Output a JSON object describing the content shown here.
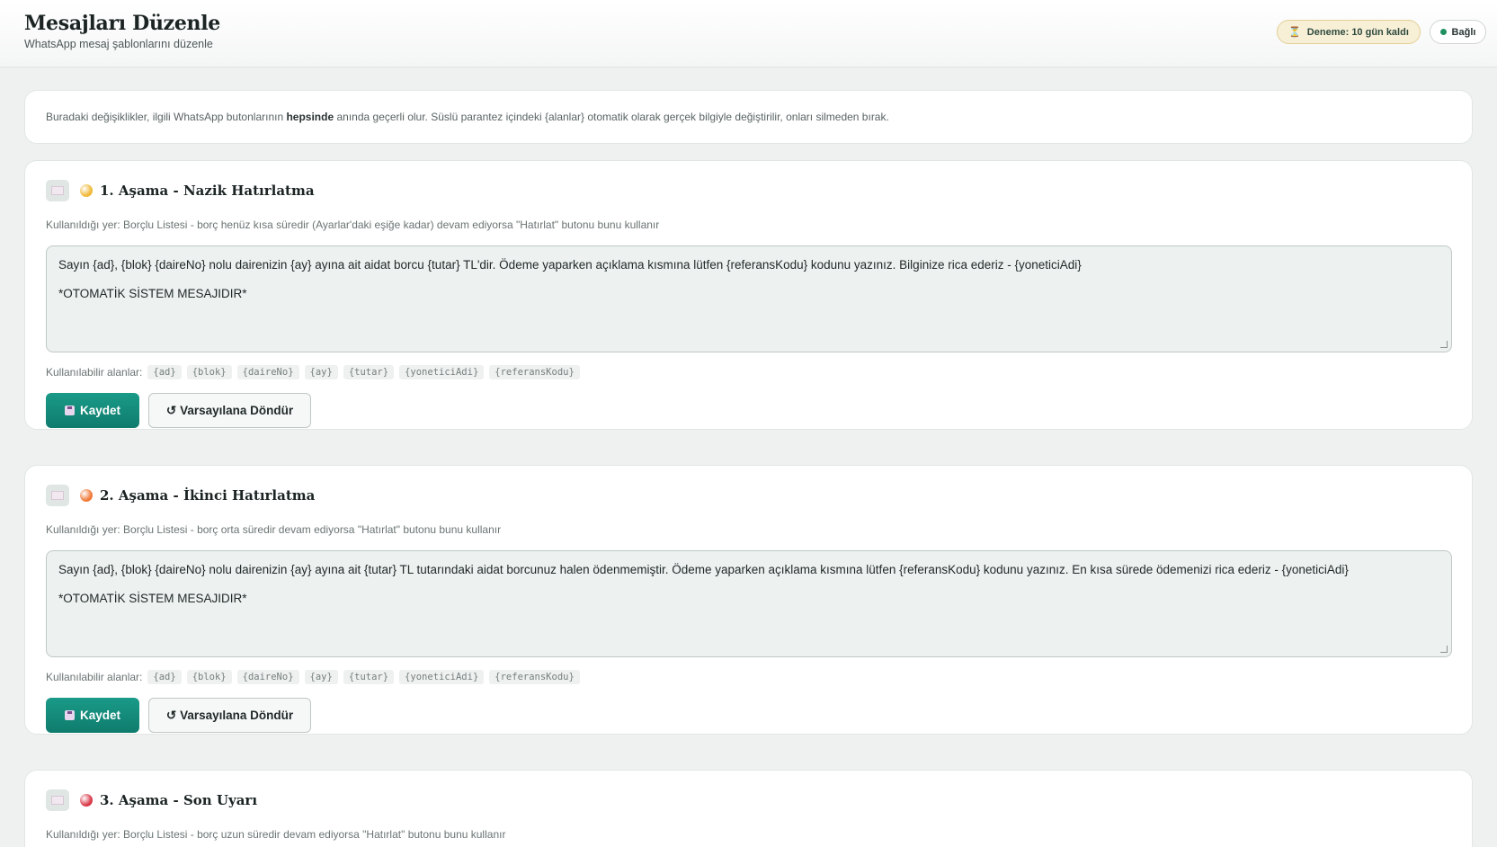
{
  "header": {
    "title": "Mesajları Düzenle",
    "subtitle": "WhatsApp mesaj şablonlarını düzenle",
    "trial_badge": "Deneme: 10 gün kaldı",
    "connection_status": "Bağlı"
  },
  "info": {
    "text_before": "Buradaki değişiklikler, ilgili WhatsApp butonlarının ",
    "text_bold": "hepsinde",
    "text_after": " anında geçerli olur. Süslü parantez içindeki {alanlar} otomatik olarak gerçek bilgiyle değiştirilir, onları silmeden bırak."
  },
  "labels": {
    "fields_label": "Kullanılabilir alanlar:",
    "save": "Kaydet",
    "reset": "Varsayılana Döndür",
    "reset_glyph": "↺"
  },
  "fields": [
    "{ad}",
    "{blok}",
    "{daireNo}",
    "{ay}",
    "{tutar}",
    "{yoneticiAdi}",
    "{referansKodu}"
  ],
  "stages": [
    {
      "title": "1. Aşama - Nazik Hatırlatma",
      "dot_color": "#f0b93a",
      "usage": "Kullanıldığı yer: Borçlu Listesi - borç henüz kısa süredir (Ayarlar'daki eşiğe kadar) devam ediyorsa \"Hatırlat\" butonu bunu kullanır",
      "message_line1": "Sayın {ad}, {blok} {daireNo} nolu dairenizin {ay} ayına ait aidat borcu {tutar} TL'dir. Ödeme yaparken açıklama kısmına lütfen {referansKodu} kodunu yazınız. Bilginize rica ederiz - {yoneticiAdi}",
      "message_line2": "*OTOMATİK SİSTEM MESAJIDIR*"
    },
    {
      "title": "2. Aşama - İkinci Hatırlatma",
      "dot_color": "#f07a3a",
      "usage": "Kullanıldığı yer: Borçlu Listesi - borç orta süredir devam ediyorsa \"Hatırlat\" butonu bunu kullanır",
      "message_line1": "Sayın {ad}, {blok} {daireNo} nolu dairenizin {ay} ayına ait {tutar} TL tutarındaki aidat borcunuz halen ödenmemiştir. Ödeme yaparken açıklama kısmına lütfen {referansKodu} kodunu yazınız. En kısa sürede ödemenizi rica ederiz - {yoneticiAdi}",
      "message_line2": "*OTOMATİK SİSTEM MESAJIDIR*"
    },
    {
      "title": "3. Aşama - Son Uyarı",
      "dot_color": "#d93b4b",
      "usage": "Kullanıldığı yer: Borçlu Listesi - borç uzun süredir devam ediyorsa \"Hatırlat\" butonu bunu kullanır"
    }
  ]
}
